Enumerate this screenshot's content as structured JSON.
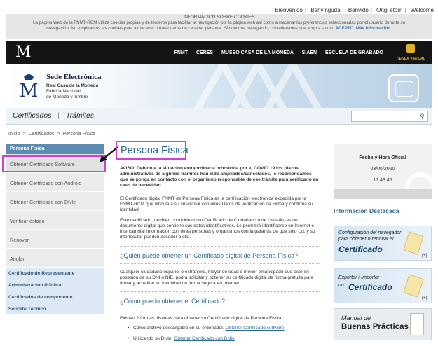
{
  "toplinks": {
    "bienvenido": "Bienvenido",
    "benvinguda": "Benvinguda",
    "benvido": "Benvido",
    "ongi": "Ongi etorri",
    "welcome": "Welcome"
  },
  "cookies": {
    "title": "INFORMACION SOBRE COOKIES",
    "line1": "La página Web de la FNMT-RCM utiliza cookies propias y de terceros para facilitar la navegación por la página web así como almacenar las preferencias seleccionadas por el usuario durante su",
    "line2": "navegación. No empleamos las cookies para almacenar o tratar datos de carácter personal. Si continúa navegando, consideramos que acepta su uso",
    "accept": "ACEPTO.",
    "more": "Más información."
  },
  "nav": {
    "items": [
      "FNMT",
      "CERES",
      "MUSEO CASA DE LA MONEDA",
      "SIAEN",
      "ESCUELA DE GRABADO"
    ],
    "tienda": "TIENDA VIRTUAL"
  },
  "banner": {
    "title": "Sede Electrónica",
    "sub1": "Real Casa de la Moneda",
    "sub2": "Fábrica Nacional",
    "sub3": "de Moneda y Timbre"
  },
  "submenu": {
    "certificados": "Certificados",
    "separator": "|",
    "tramites": "Trámites"
  },
  "breadcrumb": {
    "inicio": "Inicio",
    "certificados": "Certificados",
    "current": "Persona Física",
    "sep": ">"
  },
  "sidebar": {
    "header": "Persona Física",
    "items": [
      "Obtener Certificado Software",
      "Obtener Certificado con Android",
      "Obtener Certificado con DNIe",
      "Verificar estado",
      "Renovar",
      "Anular"
    ],
    "categories": [
      "Certificado de Representante",
      "Administración Pública",
      "Certificados de componente",
      "Soporte Técnico"
    ]
  },
  "main": {
    "title": "Persona Física",
    "aviso": "AVISO: Debido a la situación extraordinaria producida por el COVID 19 los plazos administrativos de algunos trámites han sido ampliados/cancelados, le recomendamos que se ponga en contacto con el organismo responsable de ese trámite para verificarlo en caso de necesidad.",
    "p1": "El Certificado digital FNMT de Persona Física es la certificación electrónica expedida por la FNMT-RCM que vincula a su suscriptor con unos Datos de verificación de Firma y confirma su identidad.",
    "p2": "Este certificado, también conocido como Certificado de Ciudadano o de Usuario, es un documento digital que contiene sus datos identificativos. Le permitirá identificarse en Internet e intercambiar información con otras personas y organismos con la garantía de que sólo Ud. y su interlocutor pueden acceder a ella.",
    "q1": "¿Quién puede obtener un Certificado digital de Persona Física?",
    "p3": "Cualquier ciudadano español o extranjero, mayor de edad o menor emancipado que esté en posesión de su DNI o NIE, podrá solicitar y obtener su certificado digital de forma gratuita para firmar y acreditar su identidad de forma segura en Internet.",
    "q2": "¿Cómo puedo obtener el Certificado?",
    "p4": "Existen 2 formas distintas para obtener su Certificado digital de Persona Física:",
    "b1_text": "Como archivo descargable en su ordenador.",
    "b1_link": "Obtener Certificado software",
    "b2_text": "Utilizando su DNIe.",
    "b2_link": "Obtener Certificado con DNIe"
  },
  "right": {
    "date_title": "Fecha y Hora Oficial",
    "date": "03/06/2020",
    "time": "17:43:45",
    "info_title": "Información Destacada",
    "promo1_l1": "Configuración del navegador",
    "promo1_l2": "para obtener o renovar el",
    "promo1_l3": "Certificado",
    "promo2_l1": "Exportar / Importar",
    "promo2_l2": "un",
    "promo2_l3": "Certificado",
    "plus": "[+]",
    "manual_l1": "Manual de",
    "manual_l2": "Buenas Prácticas"
  },
  "colors": {
    "accent_blue": "#2e6b94",
    "highlight_magenta": "#d23fd2",
    "sidebar_header": "#5c8cb3"
  }
}
